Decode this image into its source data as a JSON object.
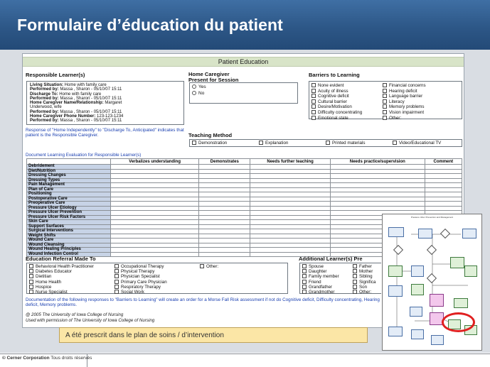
{
  "slide": {
    "title": "Formulaire d’éducation du patient",
    "footer_company": "© Cerner Corporation",
    "footer_rights": "Tous droits réservés",
    "callout_text": "A été prescrit dans le plan de soins / d’intervention"
  },
  "form": {
    "header": "Patient Education",
    "responsible_learner": {
      "title": "Responsible Learner(s)",
      "lines": [
        {
          "label": "Living Situation:",
          "value": " Home with family care"
        },
        {
          "label": "     Performed by:",
          "value": " Massa , Sharon - 05/10/07 15:11"
        },
        {
          "label": "Discharge To:",
          "value": " Home with family care"
        },
        {
          "label": "     Performed by:",
          "value": " Massa , Sharon - 05/10/07 15:11"
        },
        {
          "label": "Home Caregiver Name/Relationship:",
          "value": " Margaret"
        },
        {
          "label": "",
          "value": "Underwood, wife"
        },
        {
          "label": "     Performed by:",
          "value": " Massa , Sharon - 05/10/07 15:11"
        },
        {
          "label": "Home Caregiver Phone Number:",
          "value": " 123-123-1234"
        },
        {
          "label": "     Performed by:",
          "value": " Massa , Sharon - 05/10/07 15:11"
        }
      ],
      "note": "Response of \"Home Independently\" to \"Discharge To, Anticipated\" indicates that patient is the Responsible Caregiver."
    },
    "home_caregiver": {
      "title_line1": "Home Caregiver",
      "title_line2": "Present for Session",
      "options": [
        "Yes",
        "No"
      ]
    },
    "barriers": {
      "title": "Barriers to Learning",
      "col1": [
        "None evident",
        "Acuity of illness",
        "Cognitive deficit",
        "Cultural barrier",
        "Desire/Motivation",
        "Difficulty concentrating",
        "Emotional state"
      ],
      "col2": [
        "Financial concerns",
        "Hearing deficit",
        "Language barrier",
        "Literacy",
        "Memory problems",
        "Vision impairment",
        "Other:"
      ]
    },
    "teaching_method": {
      "title": "Teaching Method",
      "options": [
        "Demonstration",
        "Explanation",
        "Printed materials",
        "Video/Educational TV"
      ]
    },
    "evaluation": {
      "title": "Document Learning Evaluation for Responsible Learner(s)",
      "columns": [
        "",
        "Verbalizes understanding",
        "Demonstrates",
        "Needs further teaching",
        "Needs practice/supervision",
        "Comment"
      ],
      "rows": [
        "Debridement",
        "Diet/Nutrition",
        "Dressing Changes",
        "Dressing Types",
        "Pain Management",
        "Plan of Care",
        "Positioning",
        "Postoperative Care",
        "Preoperative Care",
        "Pressure Ulcer Etiology",
        "Pressure Ulcer Prevention",
        "Pressure Ulcer Risk Factors",
        "Skin Care",
        "Support Surfaces",
        "Surgical Interventions",
        "Weight Shifts",
        "Wound Care",
        "Wound Cleansing",
        "Wound Healing Principles",
        "Wound Infection Control"
      ]
    },
    "referral": {
      "title": "Education Referral Made To",
      "col1": [
        "Behavioral Health Practitioner",
        "Diabetes Educator",
        "Dietitian",
        "Home Health",
        "Hospice",
        "Nurse Specialist"
      ],
      "col2": [
        "Occupational Therapy",
        "Physical Therapy",
        "Physician Specialist",
        "Primary Care Physician",
        "Respiratory Therapy",
        "Social Work"
      ],
      "col3": [
        "Other:"
      ]
    },
    "additional": {
      "title": "Additional Learner(s) Pre",
      "col1": [
        "Spouse",
        "Daughter",
        "Family member",
        "Friend",
        "Grandfather",
        "Grandmother"
      ],
      "col2": [
        "Father",
        "Mother",
        "Sibling",
        "Significa",
        "Son",
        "Other:"
      ]
    },
    "documentation_note": "Documentation of the following responses to \"Barriers to Learning\" will create an order for a Morse Fall Risk assessment if not do Cognitive deficit, Difficulty concentrating, Hearing deficit, Memory problems.",
    "copyright_line1": "@ 2005 The University of Iowa College of Nursing",
    "copyright_line2": "Used with permission of The University of Iowa College of Nursing"
  },
  "flowchart": {
    "title": "Pressure Ulcer Prevention and Management"
  }
}
